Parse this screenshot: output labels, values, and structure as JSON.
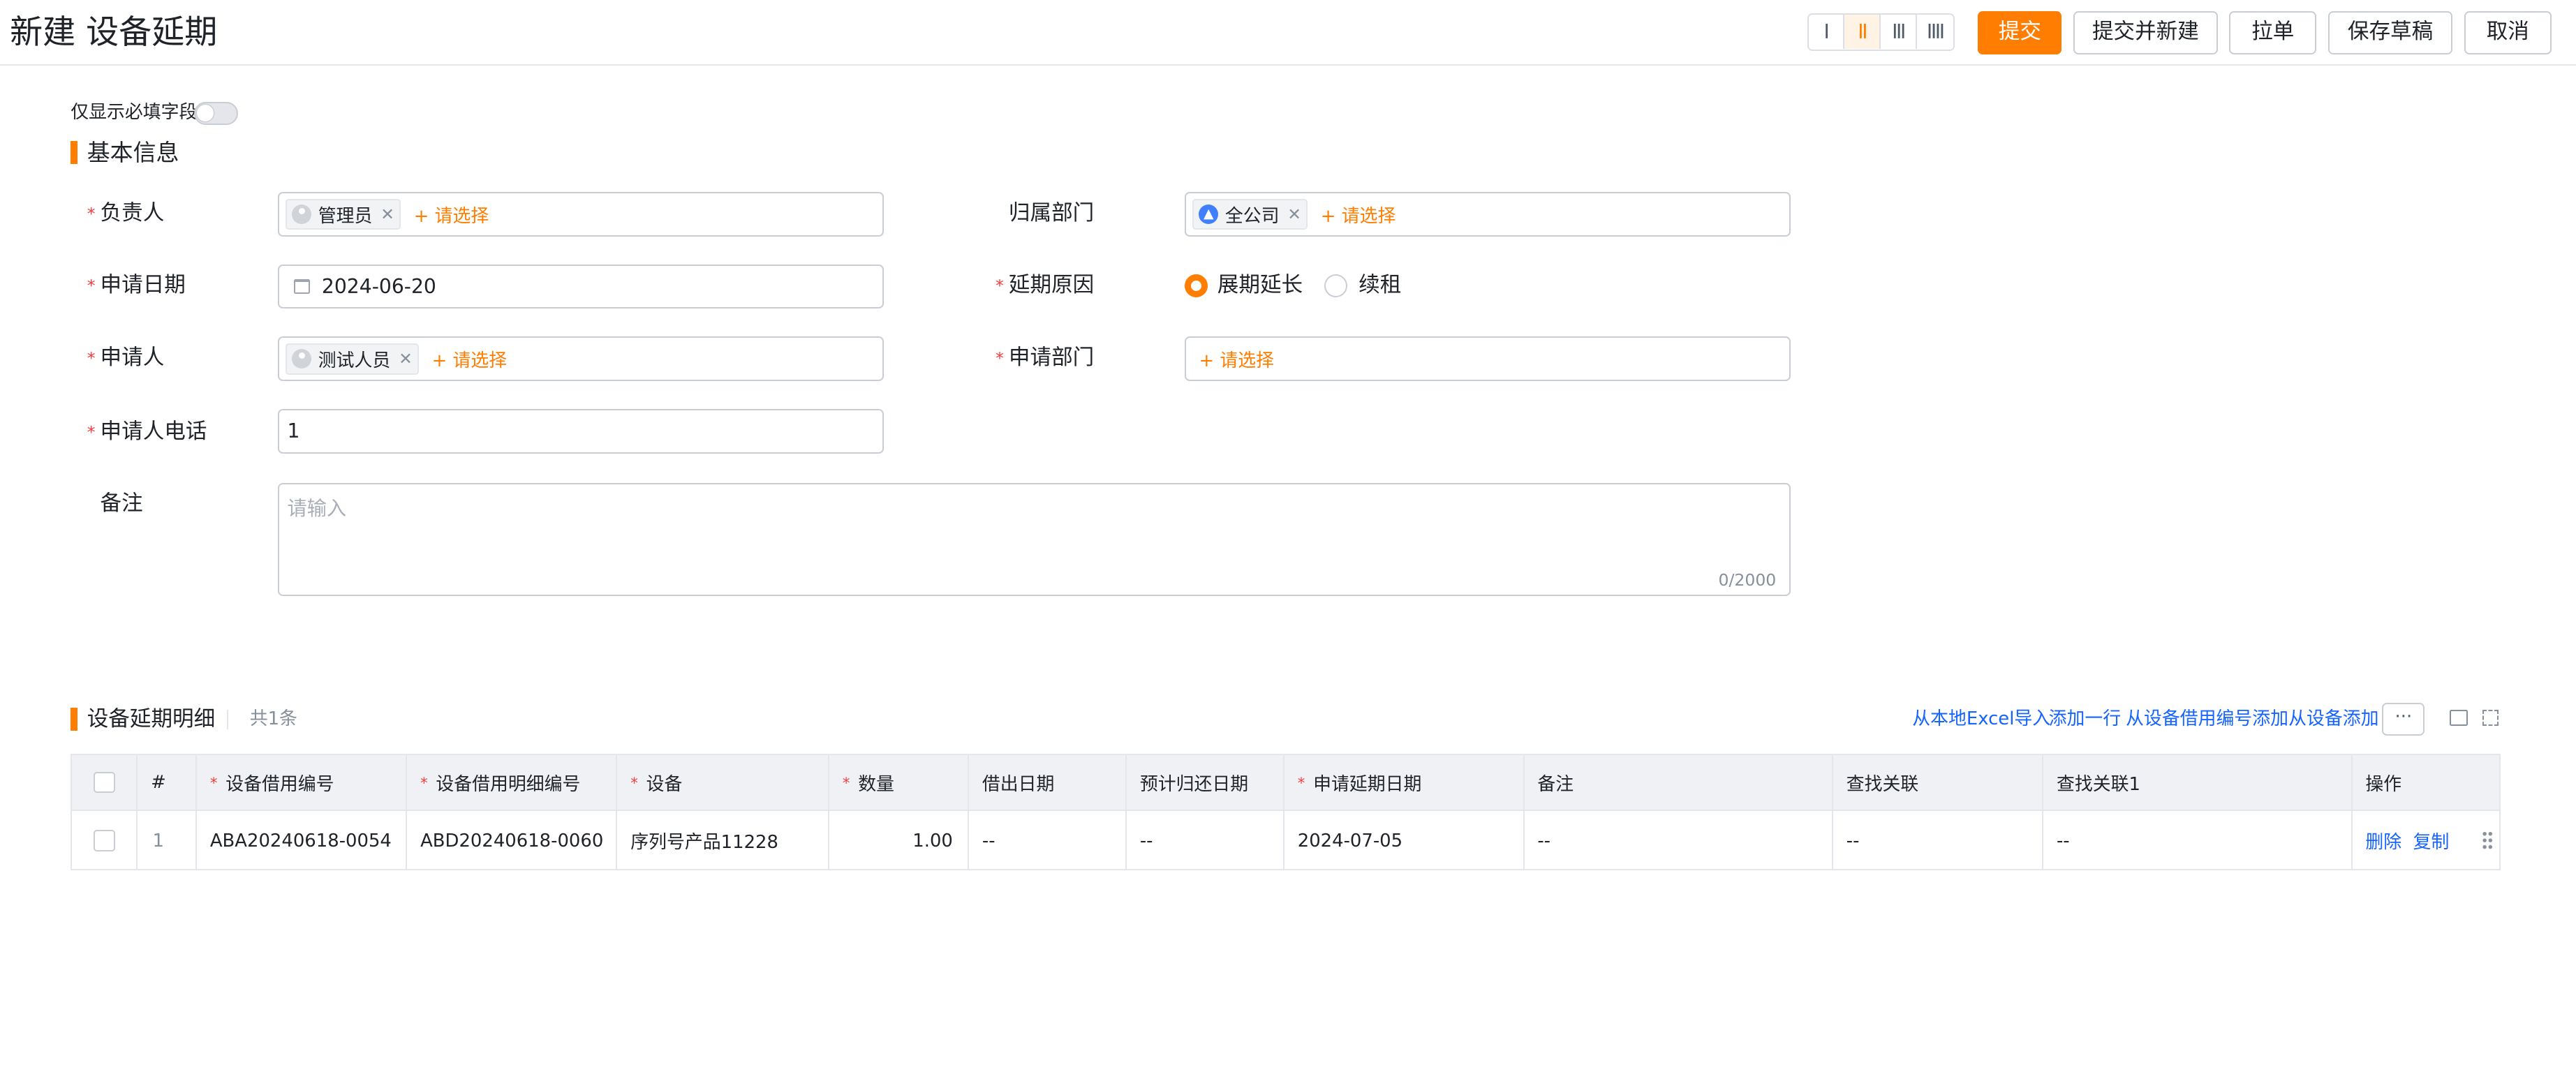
{
  "header": {
    "title": "新建 设备延期",
    "layout_options": [
      "I",
      "II",
      "III",
      "IIII"
    ],
    "buttons": {
      "submit": "提交",
      "submit_new": "提交并新建",
      "pull": "拉单",
      "save_draft": "保存草稿",
      "cancel": "取消"
    }
  },
  "form": {
    "required_only_label": "仅显示必填字段",
    "section_basic": "基本信息",
    "add_placeholder": "+ 请选择",
    "fields": {
      "owner": {
        "label": "负责人",
        "tag": "管理员"
      },
      "dept": {
        "label": "归属部门",
        "tag": "全公司"
      },
      "apply_date": {
        "label": "申请日期",
        "value": "2024-06-20"
      },
      "reason": {
        "label": "延期原因",
        "options": [
          "展期延长",
          "续租"
        ],
        "selected": "展期延长"
      },
      "applicant": {
        "label": "申请人",
        "tag": "测试人员"
      },
      "apply_dept": {
        "label": "申请部门"
      },
      "phone": {
        "label": "申请人电话",
        "value": "1"
      },
      "remark": {
        "label": "备注",
        "placeholder": "请输入",
        "counter": "0/2000"
      }
    }
  },
  "detail": {
    "title": "设备延期明细",
    "count": "共1条",
    "actions": [
      "从本地Excel导入",
      "添加一行",
      "从设备借用编号添加",
      "从设备添加"
    ],
    "more": "···",
    "columns": [
      "#",
      "设备借用编号",
      "设备借用明细编号",
      "设备",
      "数量",
      "借出日期",
      "预计归还日期",
      "申请延期日期",
      "备注",
      "查找关联",
      "查找关联1",
      "操作"
    ],
    "rows": [
      {
        "index": "1",
        "borrow_no": "ABA20240618-0054",
        "detail_no": "ABD20240618-0060",
        "device": "序列号产品11228",
        "qty": "1.00",
        "out_date": "--",
        "return_date": "--",
        "extend_date": "2024-07-05",
        "remark": "--",
        "lookup": "--",
        "lookup1": "--",
        "ops": [
          "删除",
          "复制"
        ]
      }
    ]
  },
  "colors": {
    "accent": "#ff7d00",
    "link": "#1664ff",
    "required": "#f53f3f"
  }
}
